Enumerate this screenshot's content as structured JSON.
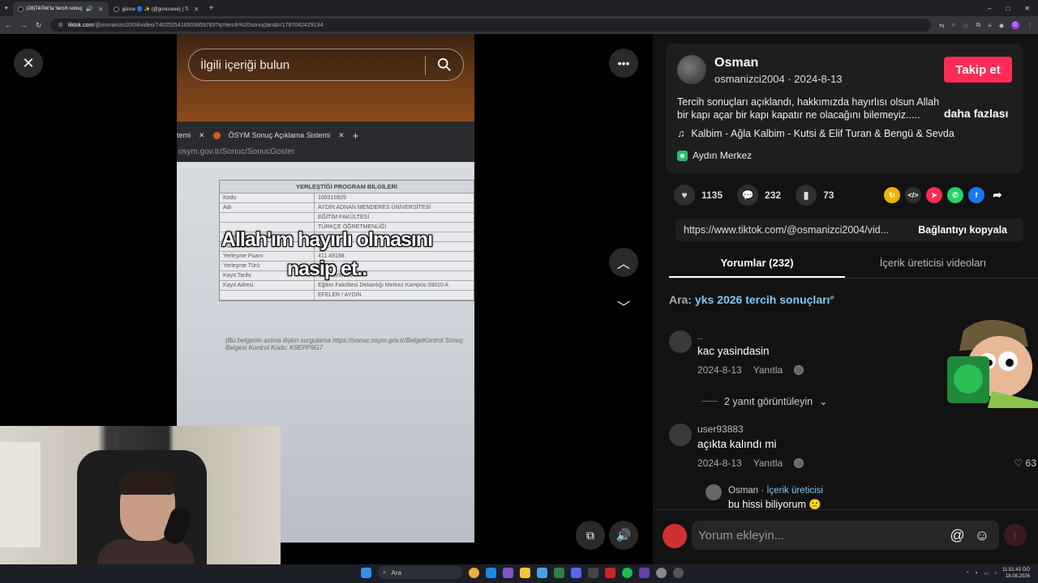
{
  "browser": {
    "tabs": [
      {
        "title": "(28)TikTok'ta 'tercih sonuç",
        "active": true
      },
      {
        "title": "günce 🔵 ✨ (@guncceee) | Ti",
        "active": false
      }
    ],
    "new_tab": "+",
    "window_controls": [
      "–",
      "□",
      "✕"
    ],
    "url_host": "tiktok.com",
    "url_rest": "/@osmanizci2004/video/7402525416503659783?q=tercih%20sonuçları&t=1787042429134"
  },
  "video": {
    "search_placeholder": "İlgili içeriği bulun",
    "caption_line1": "Allah'ım hayırlı olmasını",
    "caption_line2": "nasip et..",
    "inner_tabs": [
      "temi",
      "ÖSYM Sonuç Açıklama Sistemi"
    ],
    "inner_url": "osym.gov.tr/Sonuc/SonucGoster",
    "table_title": "YERLEŞTİĞİ PROGRAM BİLGİLERİ",
    "table_rows": [
      {
        "k": "Kodu",
        "v": "100310925"
      },
      {
        "k": "Adı",
        "v": "AYDIN ADNAN MENDERES ÜNİVERSİTESİ"
      },
      {
        "k": "",
        "v": "EĞİTİM FAKÜLTESİ"
      },
      {
        "k": "",
        "v": "TÜRKÇE ÖĞRETMENLİĞİ"
      },
      {
        "k": "Tercih Sırası",
        "v": "3"
      },
      {
        "k": "Puan Türü",
        "v": "SÖZ"
      },
      {
        "k": "Yerleşme Puanı",
        "v": "411.49198"
      },
      {
        "k": "Yerleşme Türü",
        "v": "GENEL"
      },
      {
        "k": "Kayıt Tarihi",
        "v": "19/8-23/8/2024"
      },
      {
        "k": "Kayıt Adresi",
        "v": "Eğitim Fakültesi Dekanlığı Merkez Kampüs 09010 A"
      },
      {
        "k": "",
        "v": "EFELER / AYDIN"
      }
    ],
    "table_note": "(Bu belgenin aslına ilişkin sorgulama https://sonuc.osym.gov.tr/BelgeKontrol Sonuç Belgesi Kontrol Kodu: K9EPP9G7"
  },
  "author": {
    "name": "Osman",
    "meta": "osmanizci2004 · 2024-8-13",
    "follow_label": "Takip et",
    "description": "Tercih sonuçları açıklandı, hakkımızda hayırlısı olsun Allah bir kapı açar bir kapı kapatır ne olacağını bilemeyiz.....",
    "more_label": "daha fazlası",
    "music": "Kalbim - Ağla Kalbim - Kutsi & Elif Turan & Bengü & Sevda",
    "location": "Aydın Merkez"
  },
  "stats": {
    "likes": "1135",
    "comments": "232",
    "saves": "73"
  },
  "share_icons": [
    "repost-icon",
    "embed-icon",
    "send-icon",
    "whatsapp-icon",
    "facebook-icon",
    "share-arrow-icon"
  ],
  "link": {
    "url": "https://www.tiktok.com/@osmanizci2004/vid...",
    "copy_label": "Bağlantıyı kopyala"
  },
  "tabs": {
    "comments": "Yorumlar (232)",
    "creator_videos": "İçerik üreticisi videoları"
  },
  "search_suggest": {
    "prefix": "Ara:",
    "query": "yks 2026 tercih sonuçları"
  },
  "comments": [
    {
      "user": "..",
      "text": "kac yasindasin",
      "date": "2024-8-13",
      "reply_label": "Yanıtla",
      "likes": ""
    },
    {
      "user": "user93883",
      "text": "açıkta kalındı mi",
      "date": "2024-8-13",
      "reply_label": "Yanıtla",
      "likes": "63"
    }
  ],
  "view_replies": "2 yanıt görüntüleyin",
  "creator_reply": {
    "user": "Osman",
    "sep": "·",
    "badge": "İçerik üreticisi",
    "text": "bu hissi biliyorum 😕"
  },
  "comment_input": {
    "placeholder": "Yorum ekleyin..."
  },
  "taskbar": {
    "search": "Ara",
    "time": "11:51:43 ÖÖ",
    "date": "18.08.2026"
  },
  "colors": {
    "accent": "#fe2c55",
    "link": "#7ec8ff",
    "panel_bg": "#121212"
  }
}
